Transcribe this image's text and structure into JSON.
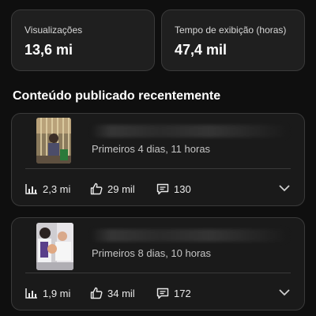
{
  "section_title": "Conteúdo publicado recentemente",
  "stats": [
    {
      "label": "Visualizações",
      "value": "13,6 mi"
    },
    {
      "label": "Tempo de exibição (horas)",
      "value": "47,4 mil"
    }
  ],
  "videos": [
    {
      "subtitle": "Primeiros 4 dias, 11 horas",
      "views": "2,3 mi",
      "likes": "29 mil",
      "comments": "130"
    },
    {
      "subtitle": "Primeiros 8 dias, 10 horas",
      "views": "1,9 mi",
      "likes": "34 mil",
      "comments": "172"
    }
  ],
  "icons": {
    "views": "bar-chart-icon",
    "likes": "thumbs-up-icon",
    "comments": "comment-icon",
    "expand": "chevron-down-icon"
  },
  "colors": {
    "background": "#0f0f0f",
    "card": "#1f1f1f",
    "border": "#3a3a3a",
    "text": "#f1f1f1",
    "muted": "#c4c4c4"
  }
}
